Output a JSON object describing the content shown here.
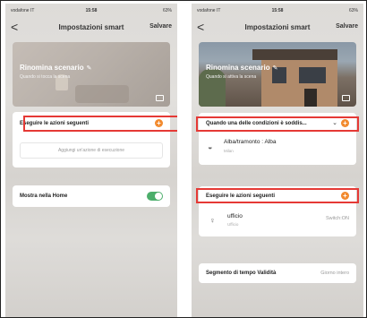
{
  "left": {
    "status": {
      "carrier": "vodafone IT",
      "time": "15:58",
      "battery": "63%"
    },
    "nav": {
      "back": "<",
      "title": "Impostazioni smart",
      "save": "Salvare"
    },
    "hero": {
      "name": "Rinomina scenario",
      "sub": "Quando si tocca la scena"
    },
    "actions": {
      "title": "Eseguire le azioni seguenti",
      "placeholder": "Aggiungi un'azione di esecuzione"
    },
    "home": {
      "label": "Mostra nella Home",
      "toggle_on": true
    }
  },
  "right": {
    "status": {
      "carrier": "vodafone IT",
      "time": "15:58",
      "battery": "63%"
    },
    "nav": {
      "back": "<",
      "title": "Impostazioni smart",
      "save": "Salvare"
    },
    "hero": {
      "name": "Rinomina scenario",
      "sub": "Quando si attiva la scena"
    },
    "conditions": {
      "title": "Quando una delle condizioni è soddis...",
      "item": {
        "title": "Alba/tramonto : Alba",
        "sub": "Milan"
      }
    },
    "actions": {
      "title": "Eseguire le azioni seguenti",
      "item": {
        "title": "ufficio",
        "sub": "Ufficio",
        "value": "Switch:ON"
      }
    },
    "validity": {
      "label": "Segmento di tempo Validità",
      "value": "Giorno intero"
    }
  },
  "colors": {
    "accent": "#f28a2e",
    "highlight": "#e53935",
    "toggle": "#4cae6b"
  },
  "icons": {
    "back": "chevron-left-icon",
    "plus": "plus-circle-icon",
    "sunrise": "sunrise-icon",
    "bulb": "lightbulb-icon",
    "image": "image-icon"
  }
}
